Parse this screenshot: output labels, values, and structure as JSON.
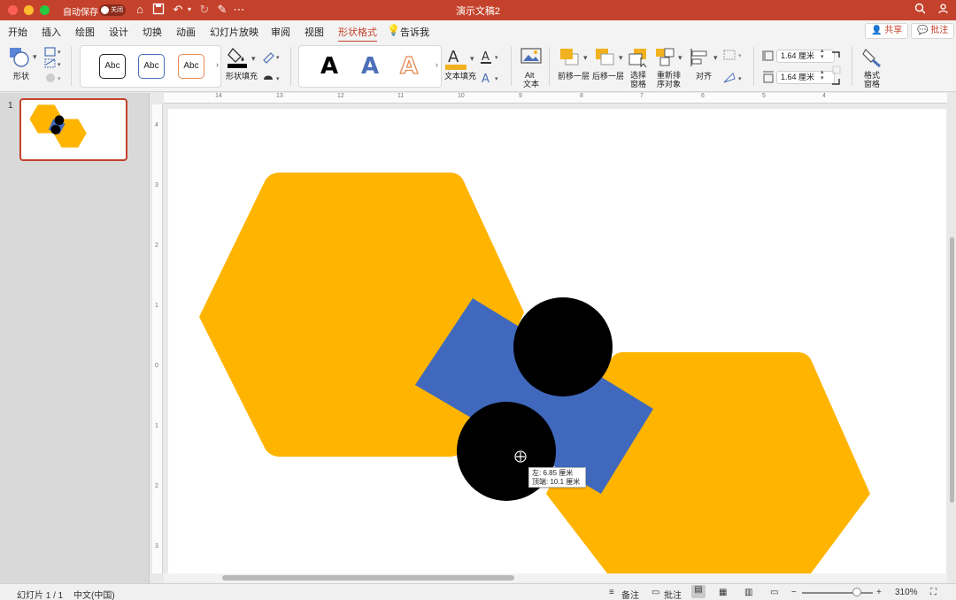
{
  "window": {
    "autosave_label": "自动保存",
    "autosave_state": "关闭",
    "title": "演示文稿2"
  },
  "tabs": [
    "开始",
    "插入",
    "绘图",
    "设计",
    "切换",
    "动画",
    "幻灯片放映",
    "审阅",
    "视图",
    "形状格式",
    "告诉我"
  ],
  "active_tab": "形状格式",
  "header_buttons": {
    "share": "共享",
    "comment": "批注"
  },
  "ribbon": {
    "shape_label": "形状",
    "style_labels": [
      "Abc",
      "Abc",
      "Abc"
    ],
    "shape_fill_label": "形状填充",
    "wordart_letters": [
      "A",
      "A",
      "A"
    ],
    "text_fill_label": "文本填充",
    "alt_text_label_1": "Alt",
    "alt_text_label_2": "文本",
    "bring_forward": "前移一层",
    "send_backward": "后移一层",
    "selection_pane_1": "选择",
    "selection_pane_2": "窗格",
    "reorder_1": "重新排",
    "reorder_2": "序对象",
    "align": "对齐",
    "height_value": "1.64 厘米",
    "width_value": "1.64 厘米",
    "format_pane_1": "格式",
    "format_pane_2": "窗格"
  },
  "colors": {
    "accent": "#c4422b",
    "hexagon": "#ffb500",
    "rectangle": "#4069be",
    "circle": "#000000"
  },
  "slides_pane": {
    "number": "1"
  },
  "hruler_numbers": [
    "14",
    "13",
    "12",
    "11",
    "10",
    "9",
    "8",
    "7",
    "6",
    "5",
    "4"
  ],
  "vruler_numbers": [
    "4",
    "3",
    "2",
    "1",
    "0",
    "1",
    "2",
    "3"
  ],
  "tooltip": {
    "left": "左: 6.85 厘米",
    "top": "顶端: 10.1 厘米"
  },
  "status": {
    "slide_counter": "幻灯片 1 / 1",
    "language": "中文(中国)",
    "notes": "备注",
    "comments": "批注",
    "zoom": "310%"
  }
}
